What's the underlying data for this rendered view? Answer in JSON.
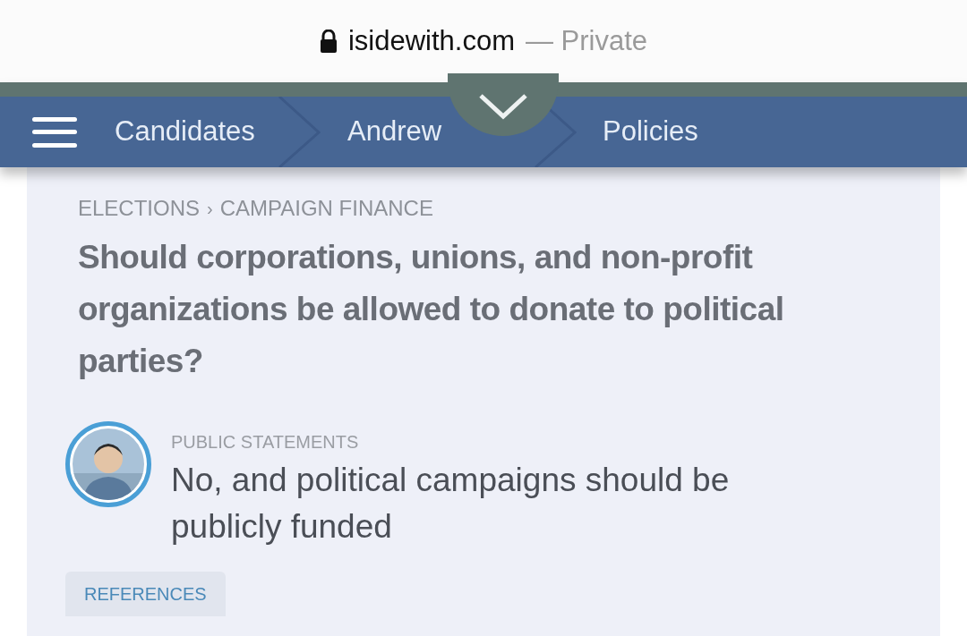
{
  "address_bar": {
    "domain": "isidewith.com",
    "mode": "— Private"
  },
  "nav": {
    "toggle": {
      "expanded": false
    },
    "items": [
      {
        "label": "Candidates"
      },
      {
        "label": "Andrew"
      },
      {
        "label": "Policies"
      }
    ]
  },
  "breadcrumb": {
    "items": [
      "ELECTIONS",
      "CAMPAIGN FINANCE"
    ],
    "separator": "›"
  },
  "question": "Should corporations, unions, and non-profit organizations be allowed to donate to political parties?",
  "statement": {
    "label": "PUBLIC STATEMENTS",
    "text": "No, and political campaigns should be publicly funded"
  },
  "tabs": [
    {
      "label": "REFERENCES"
    }
  ]
}
